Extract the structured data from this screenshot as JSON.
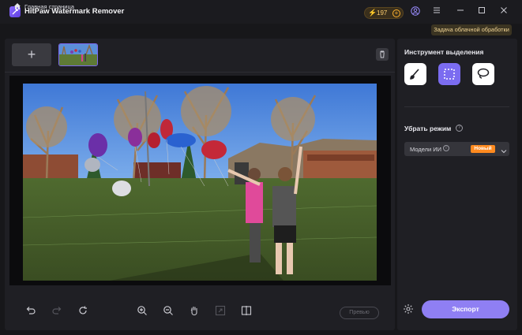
{
  "app": {
    "title": "HitPaw Watermark Remover",
    "credits": "197"
  },
  "titlebar": {
    "icons": [
      "coin-plus-icon",
      "user-icon",
      "menu-icon",
      "minimize-icon",
      "maximize-icon",
      "close-icon"
    ]
  },
  "breadcrumb": {
    "home_label": "Главная страница",
    "cloud_task_label": "Задача облачной обработки"
  },
  "thumbstrip": {
    "add_label": "+"
  },
  "right_panel": {
    "selection_tool_title": "Инструмент выделения",
    "tools": [
      "brush-icon",
      "rectangle-select-icon",
      "lasso-icon"
    ],
    "active_tool": "rectangle-select-icon",
    "remove_mode_title": "Убрать режим",
    "mode_select": {
      "value": "Модели ИИ",
      "badge": "Новый"
    },
    "export_label": "Экспорт"
  },
  "bottom_toolbar": {
    "icons": [
      "undo-icon",
      "redo-icon",
      "reset-icon",
      "zoom-in-icon",
      "zoom-out-icon",
      "hand-pan-icon",
      "fit-screen-icon",
      "compare-icon"
    ],
    "preview_label": "Превью"
  },
  "colors": {
    "accent": "#8f7ff3",
    "badge": "#ff8a1f",
    "panel": "#1f1f24",
    "background": "#17171a"
  }
}
